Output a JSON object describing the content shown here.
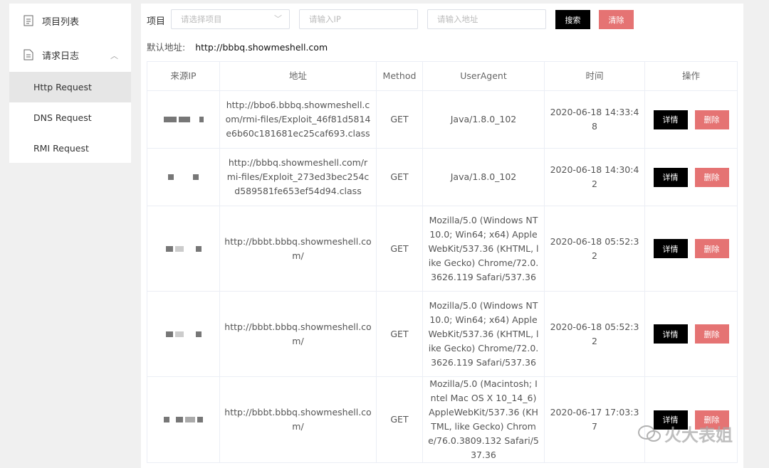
{
  "sidebar": {
    "project_list": "项目列表",
    "request_log": "请求日志",
    "sub_items": [
      "Http Request",
      "DNS Request",
      "RMI Request"
    ]
  },
  "filter": {
    "label": "项目",
    "select_placeholder": "请选择项目",
    "ip_placeholder": "请输入IP",
    "addr_placeholder": "请输入地址",
    "search": "搜索",
    "clear": "清除"
  },
  "default_address": {
    "label": "默认地址:",
    "value": "http://bbbq.showmeshell.com"
  },
  "table": {
    "headers": [
      "来源IP",
      "地址",
      "Method",
      "UserAgent",
      "时间",
      "操作"
    ],
    "detail_label": "详情",
    "delete_label": "删除",
    "rows": [
      {
        "addr": "http://bbo6.bbbq.showmeshell.com/rmi-files/Exploit_46f81d5814e6b60c181681ec25caf693.class",
        "method": "GET",
        "ua": "Java/1.8.0_102",
        "time": "2020-06-18 14:33:48"
      },
      {
        "addr": "http://bbbq.showmeshell.com/rmi-files/Exploit_273ed3bec254cd589581fe653ef54d94.class",
        "method": "GET",
        "ua": "Java/1.8.0_102",
        "time": "2020-06-18 14:30:42"
      },
      {
        "addr": "http://bbbt.bbbq.showmeshell.com/",
        "method": "GET",
        "ua": "Mozilla/5.0 (Windows NT 10.0; Win64; x64) AppleWebKit/537.36 (KHTML, like Gecko) Chrome/72.0.3626.119 Safari/537.36",
        "time": "2020-06-18 05:52:32"
      },
      {
        "addr": "http://bbbt.bbbq.showmeshell.com/",
        "method": "GET",
        "ua": "Mozilla/5.0 (Windows NT 10.0; Win64; x64) AppleWebKit/537.36 (KHTML, like Gecko) Chrome/72.0.3626.119 Safari/537.36",
        "time": "2020-06-18 05:52:32"
      },
      {
        "addr": "http://bbbt.bbbq.showmeshell.com/",
        "method": "GET",
        "ua": "Mozilla/5.0 (Macintosh; Intel Mac OS X 10_14_6) AppleWebKit/537.36 (KHTML, like Gecko) Chrome/76.0.3809.132 Safari/537.36",
        "time": "2020-06-17 17:03:37"
      }
    ]
  },
  "watermark": "火大表姐"
}
